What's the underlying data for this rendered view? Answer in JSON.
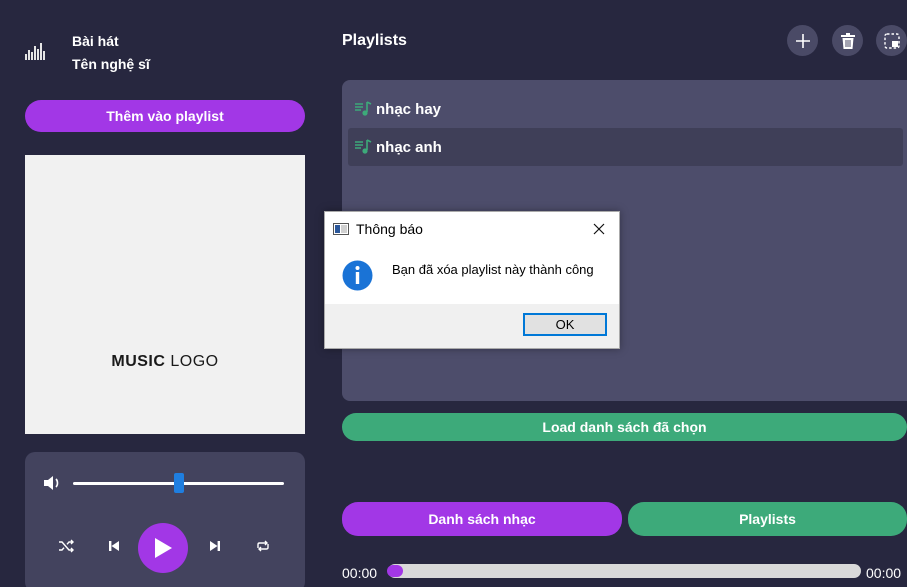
{
  "now_playing": {
    "title": "Bài hát",
    "artist": "Tên nghệ sĩ",
    "icon": "equalizer-icon"
  },
  "add_to_playlist_label": "Thêm vào playlist",
  "album_art": {
    "logo_bold": "MUSIC",
    "logo_light": " LOGO",
    "colors": {
      "heart_top": "#e8327a",
      "heart_bottom": "#f66655"
    }
  },
  "player": {
    "volume_fraction": 0.5,
    "icons": [
      "volume-icon",
      "shuffle-icon",
      "previous-icon",
      "play-icon",
      "next-icon",
      "repeat-icon"
    ]
  },
  "playlists": {
    "heading": "Playlists",
    "items": [
      {
        "label": "nhạc hay",
        "selected": false
      },
      {
        "label": "nhạc anh",
        "selected": true
      }
    ],
    "load_label": "Load danh sách đã chọn"
  },
  "bottom_tabs": {
    "songs_label": "Danh sách nhạc",
    "playlists_label": "Playlists"
  },
  "progress": {
    "current_time": "00:00",
    "total_time": "00:00",
    "fraction": 0.0
  },
  "dialog": {
    "title": "Thông báo",
    "message": "Bạn đã xóa playlist này thành công",
    "ok_label": "OK"
  },
  "colors": {
    "background": "#27273f",
    "accent_purple": "#a237e6",
    "accent_green": "#3daa7a",
    "panel": "#4d4d6b"
  }
}
